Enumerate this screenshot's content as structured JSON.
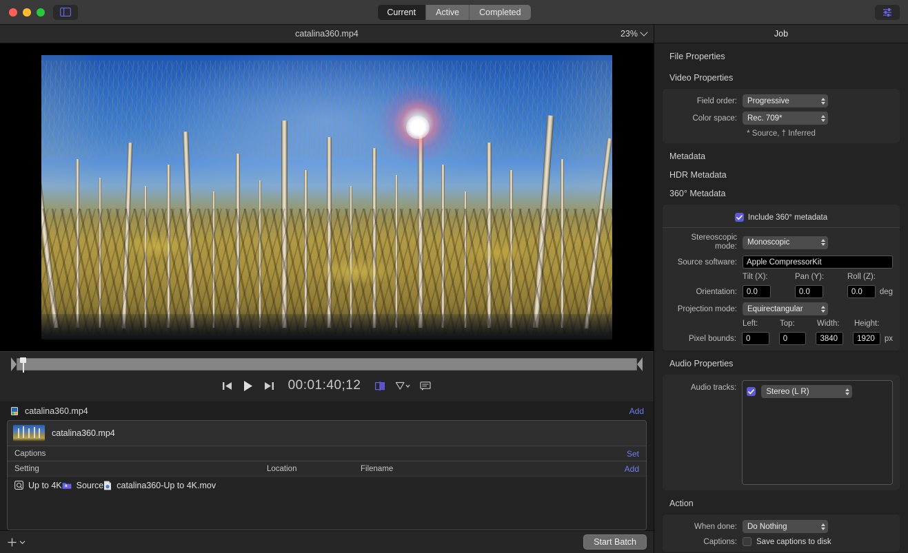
{
  "titlebar": {
    "sidebar_toggle_icon": "sidebar-icon",
    "segments": [
      {
        "label": "Current",
        "active": true
      },
      {
        "label": "Active",
        "active": false
      },
      {
        "label": "Completed",
        "active": false
      }
    ],
    "right_tool_icon": "sliders-icon"
  },
  "preview": {
    "title": "catalina360.mp4",
    "zoom": "23%",
    "zoom_chevron_icon": "chevron-down-icon",
    "image_alt": "equirectangular-360-aspen-forest"
  },
  "transport": {
    "prev_icon": "skip-to-start-icon",
    "play_icon": "play-icon",
    "next_icon": "skip-to-end-icon",
    "timecode": "00:01:40;12",
    "split_view_icon": "split-view-icon",
    "marker_icon": "marker-shield-icon",
    "marker_chevron_icon": "chevron-down-icon",
    "captions_icon": "captions-icon"
  },
  "batch": {
    "job_icon": "movie-file-icon",
    "job_name": "catalina360.mp4",
    "add_label": "Add",
    "card": {
      "thumbnail_icon": "video-thumbnail",
      "filename": "catalina360.mp4",
      "captions_label": "Captions",
      "captions_action": "Set",
      "columns": {
        "setting": "Setting",
        "location": "Location",
        "filename": "Filename",
        "action": "Add"
      },
      "rows": [
        {
          "setting_icon": "compressor-setting-icon",
          "setting": "Up to 4K",
          "location_icon": "folder-icon",
          "location": "Source",
          "file_icon": "mov-file-icon",
          "filename": "catalina360-Up to 4K.mov"
        }
      ]
    },
    "footer": {
      "add_icon": "plus-icon",
      "add_chevron_icon": "chevron-down-icon",
      "start_batch": "Start Batch"
    }
  },
  "inspector": {
    "header": "Job",
    "sections": {
      "file_properties": "File Properties",
      "video_properties": "Video Properties",
      "metadata": "Metadata",
      "hdr_metadata": "HDR Metadata",
      "metadata_360": "360° Metadata",
      "audio_properties": "Audio Properties",
      "action": "Action"
    },
    "video": {
      "field_order_label": "Field order:",
      "field_order_value": "Progressive",
      "color_space_label": "Color space:",
      "color_space_value": "Rec. 709*",
      "footnote": "* Source, † Inferred"
    },
    "meta360": {
      "include_label": "Include 360° metadata",
      "include_checked": true,
      "stereoscopic_label": "Stereoscopic mode:",
      "stereoscopic_value": "Monoscopic",
      "source_software_label": "Source software:",
      "source_software_value": "Apple CompressorKit",
      "orientation_label": "Orientation:",
      "tilt_label": "Tilt (X):",
      "tilt_value": "0.0",
      "pan_label": "Pan (Y):",
      "pan_value": "0.0",
      "roll_label": "Roll (Z):",
      "roll_value": "0.0",
      "deg_unit": "deg",
      "projection_label": "Projection mode:",
      "projection_value": "Equirectangular",
      "left_label": "Left:",
      "left_value": "0",
      "top_label": "Top:",
      "top_value": "0",
      "width_label": "Width:",
      "width_value": "3840",
      "height_label": "Height:",
      "height_value": "1920",
      "pixel_bounds_label": "Pixel bounds:",
      "px_unit": "px"
    },
    "audio": {
      "tracks_label": "Audio tracks:",
      "track_checked": true,
      "track_value": "Stereo (L R)"
    },
    "action": {
      "when_done_label": "When done:",
      "when_done_value": "Do Nothing",
      "captions_label": "Captions:",
      "save_captions_label": "Save captions to disk",
      "save_captions_checked": false
    }
  },
  "colors": {
    "accent": "#5b5bd6",
    "link": "#6d7ef0",
    "window_bg": "#1e1e1e",
    "panel_bg": "#232323"
  }
}
